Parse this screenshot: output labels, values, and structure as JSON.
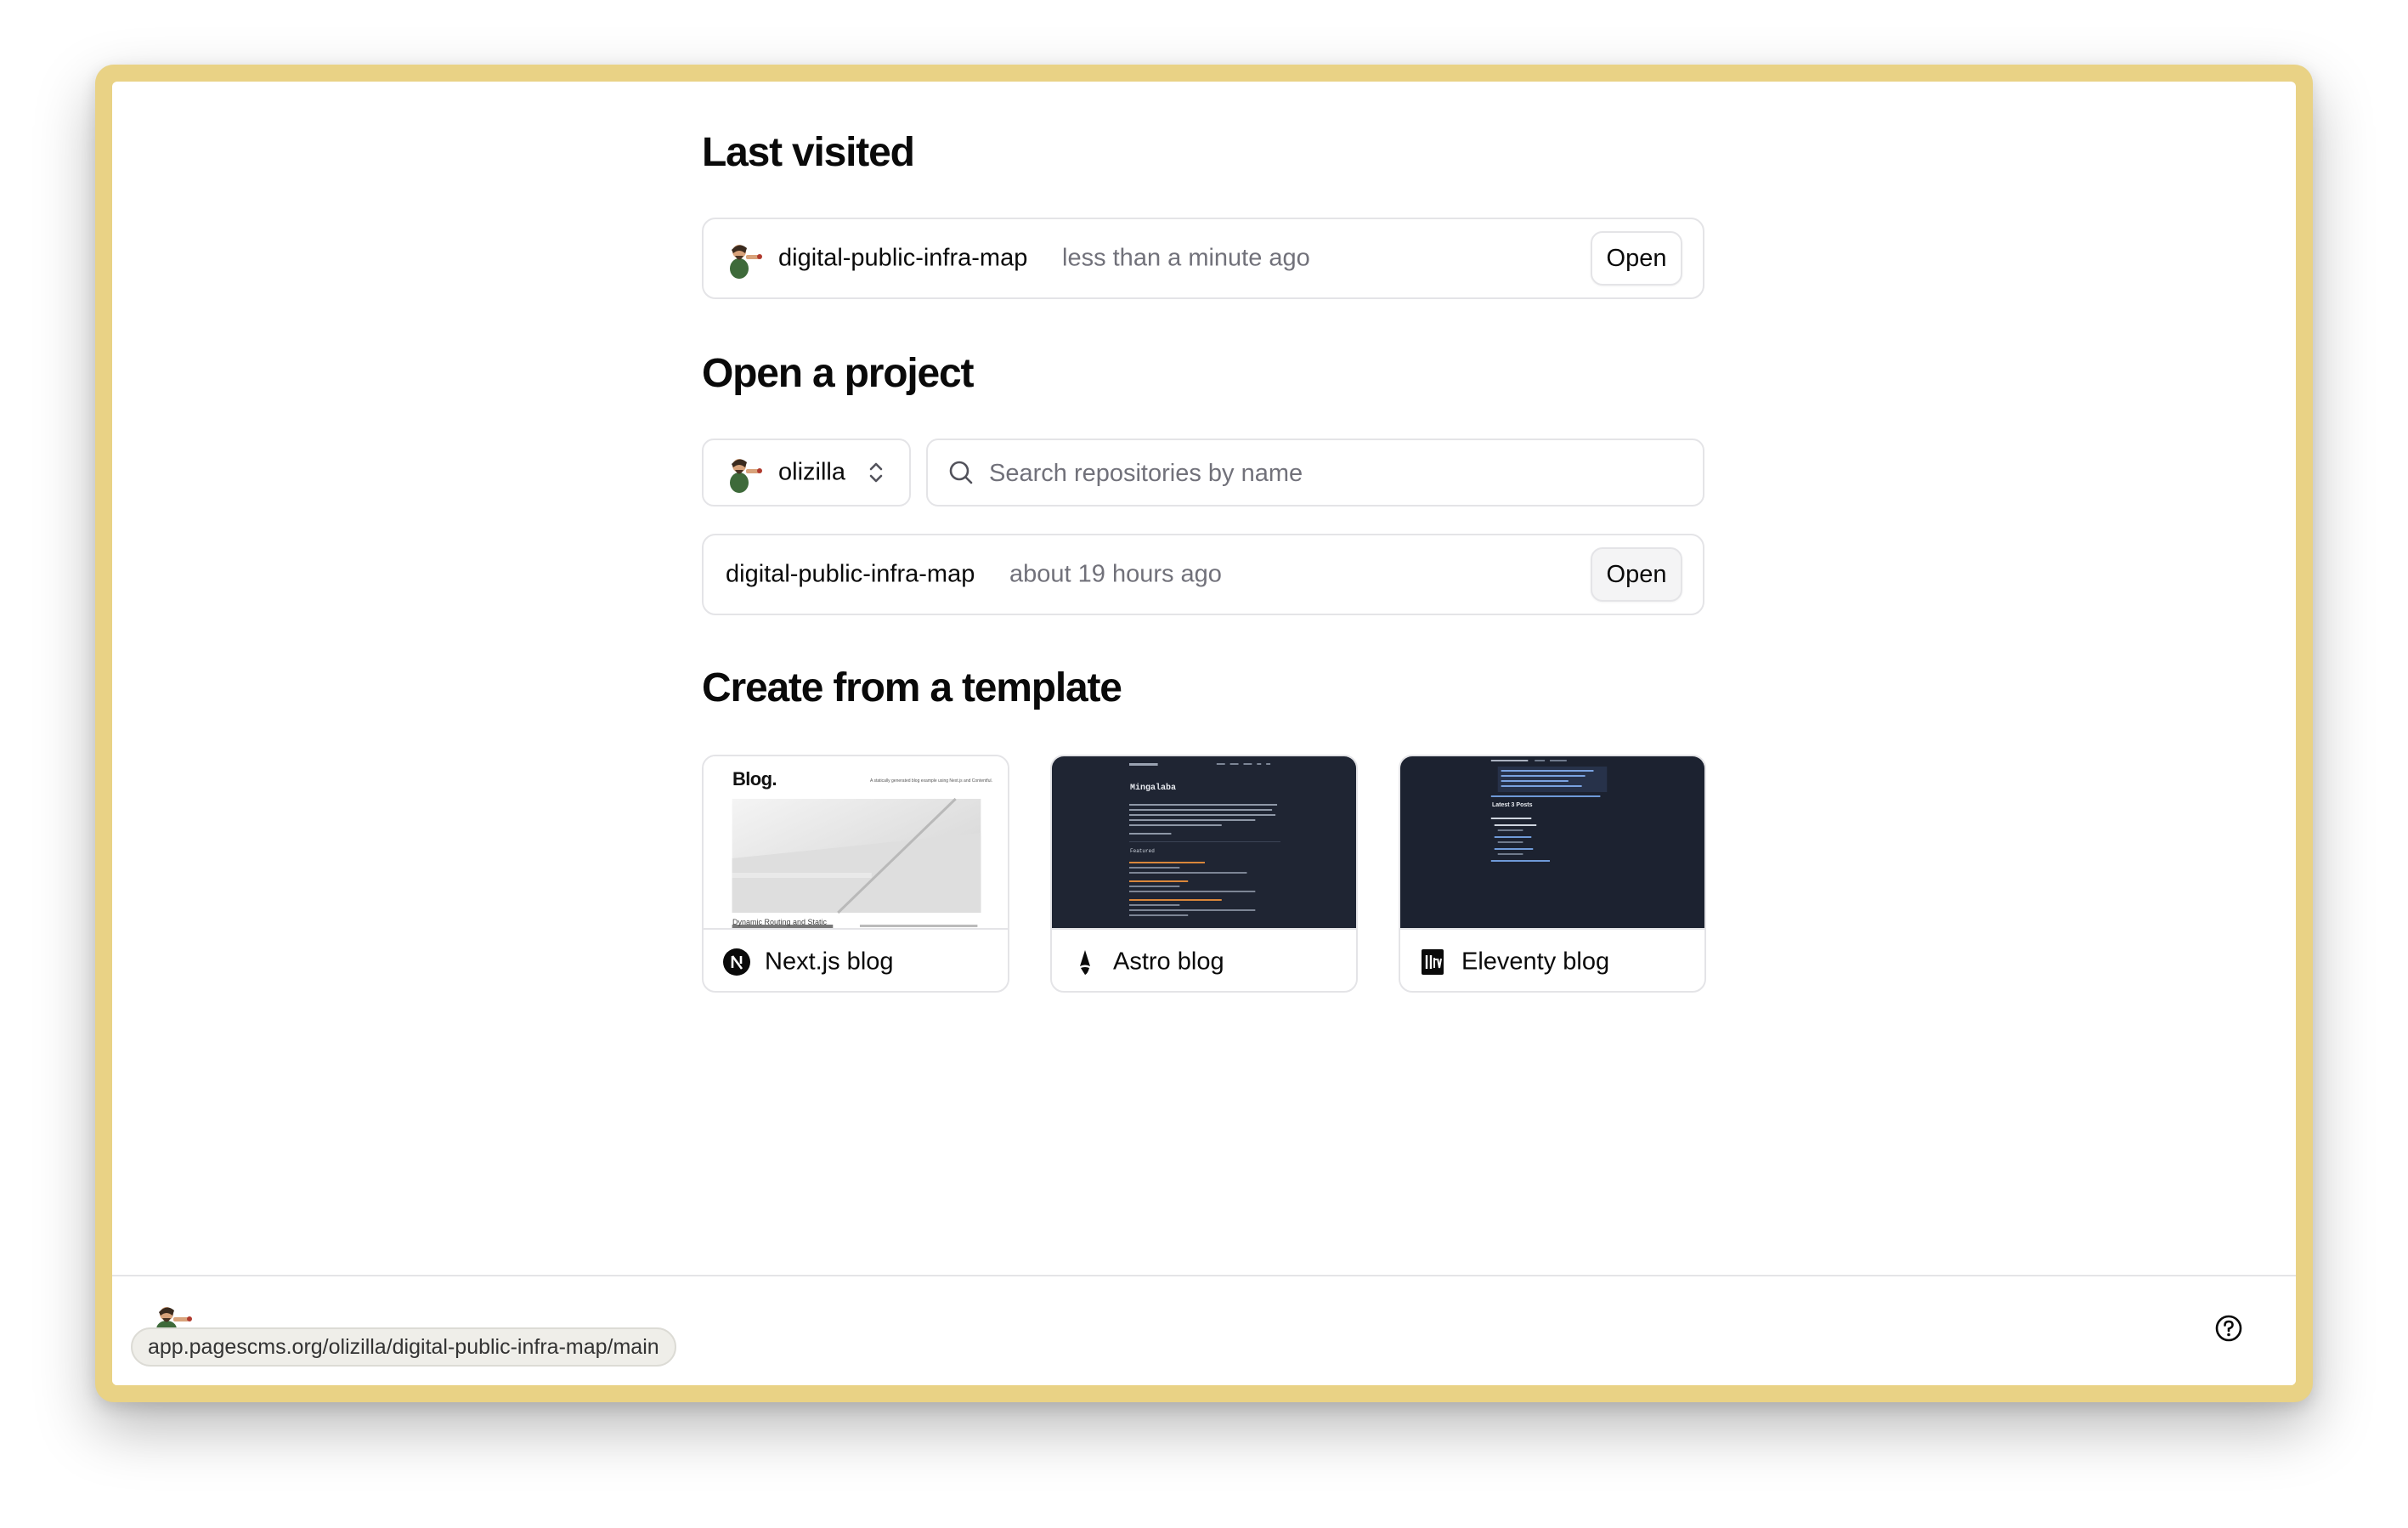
{
  "last_visited": {
    "title": "Last visited",
    "item": {
      "name": "digital-public-infra-map",
      "time": "less than a minute ago",
      "open_label": "Open"
    }
  },
  "open_project": {
    "title": "Open a project",
    "owner": "olizilla",
    "search_placeholder": "Search repositories by name",
    "repos": [
      {
        "name": "digital-public-infra-map",
        "time": "about 19 hours ago",
        "open_label": "Open"
      }
    ]
  },
  "templates": {
    "title": "Create from a template",
    "items": [
      {
        "label": "Next.js blog",
        "icon": "nextjs-icon",
        "thumb_title": "Blog.",
        "thumb_tagline": "A statically generated blog example using Next.js and Contentful.",
        "thumb_post": "Dynamic Routing and Static"
      },
      {
        "label": "Astro blog",
        "icon": "astro-icon",
        "thumb_title": "Mingalaba",
        "thumb_section": "Featured"
      },
      {
        "label": "Eleventy blog",
        "icon": "eleventy-icon",
        "thumb_section": "Latest 3 Posts"
      }
    ]
  },
  "status_bar": {
    "url": "app.pagescms.org/olizilla/digital-public-infra-map/main"
  },
  "colors": {
    "frame": "#e9d285",
    "border": "#e4e4e7",
    "muted": "#71717a",
    "dark_thumb": "#1f2533"
  }
}
